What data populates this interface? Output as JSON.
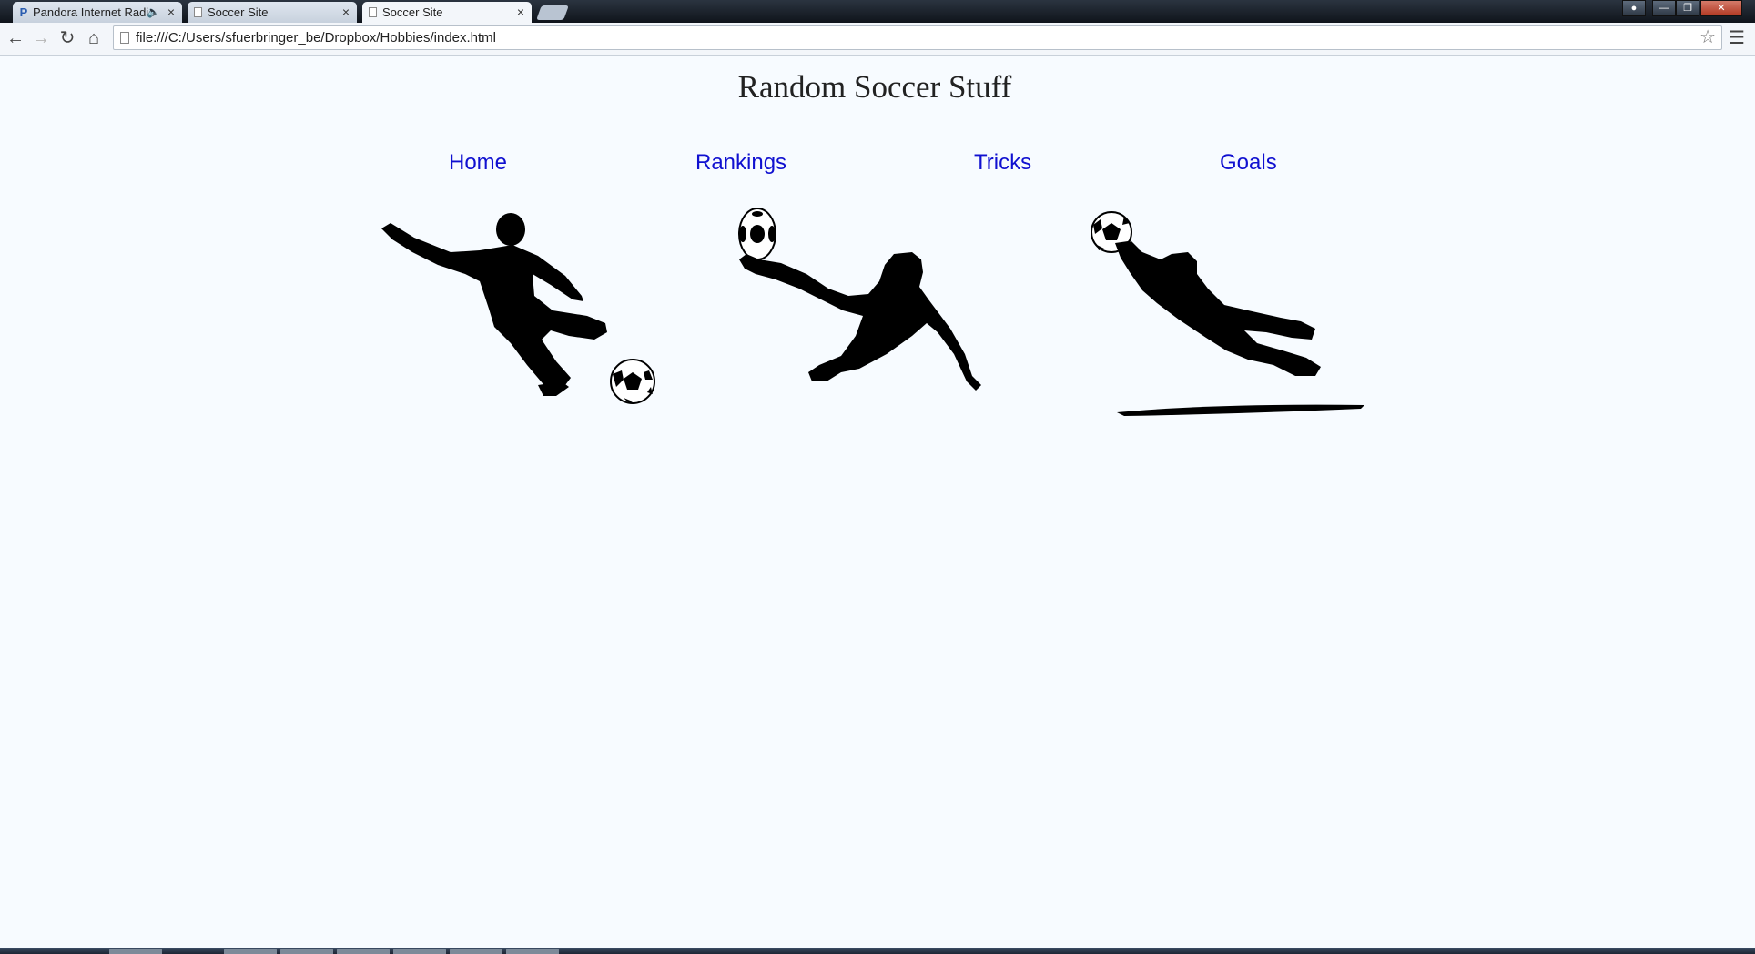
{
  "browser": {
    "tabs": [
      {
        "title": "Pandora Internet Radio",
        "icon": "pandora-icon",
        "audio": true,
        "active": false
      },
      {
        "title": "Soccer Site",
        "icon": "page-icon",
        "audio": false,
        "active": false
      },
      {
        "title": "Soccer Site",
        "icon": "page-icon",
        "audio": false,
        "active": true
      }
    ],
    "address_bar": {
      "url": "file:///C:/Users/sfuerbringer_be/Dropbox/Hobbies/index.html"
    },
    "icons": {
      "back": "back-arrow-icon",
      "forward": "forward-arrow-icon",
      "reload": "reload-icon",
      "home": "home-icon",
      "bookmark": "star-icon",
      "menu": "menu-icon"
    }
  },
  "page": {
    "title": "Random Soccer Stuff",
    "nav": [
      {
        "label": "Home"
      },
      {
        "label": "Rankings"
      },
      {
        "label": "Tricks"
      },
      {
        "label": "Goals"
      }
    ],
    "images": [
      {
        "subject": "soccer player kicking ball silhouette"
      },
      {
        "subject": "soccer player bicycle kick silhouette"
      },
      {
        "subject": "goalkeeper diving save silhouette"
      }
    ],
    "colors": {
      "background": "#f7fbff",
      "link": "#1010d0",
      "title": "#222222"
    }
  }
}
